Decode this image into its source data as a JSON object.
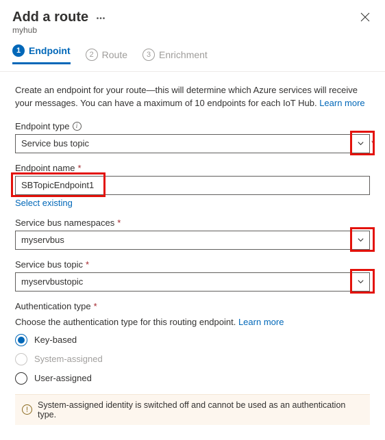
{
  "header": {
    "title": "Add a route",
    "subtitle": "myhub"
  },
  "steps": [
    {
      "num": "1",
      "label": "Endpoint"
    },
    {
      "num": "2",
      "label": "Route"
    },
    {
      "num": "3",
      "label": "Enrichment"
    }
  ],
  "intro": {
    "text": "Create an endpoint for your route—this will determine which Azure services will receive your messages. You can have a maximum of 10 endpoints for each IoT Hub. ",
    "link": "Learn more"
  },
  "fields": {
    "endpoint_type": {
      "label": "Endpoint type",
      "value": "Service bus topic"
    },
    "endpoint_name": {
      "label": "Endpoint name",
      "value": "SBTopicEndpoint1",
      "select_existing": "Select existing"
    },
    "namespace": {
      "label": "Service bus namespaces",
      "value": "myservbus"
    },
    "topic": {
      "label": "Service bus topic",
      "value": "myservbustopic"
    }
  },
  "auth": {
    "label": "Authentication type",
    "note_prefix": "Choose the authentication type for this routing endpoint. ",
    "note_link": "Learn more",
    "options": {
      "key": "Key-based",
      "sys": "System-assigned",
      "user": "User-assigned"
    }
  },
  "banner": "System-assigned identity is switched off and cannot be used as an authentication type."
}
